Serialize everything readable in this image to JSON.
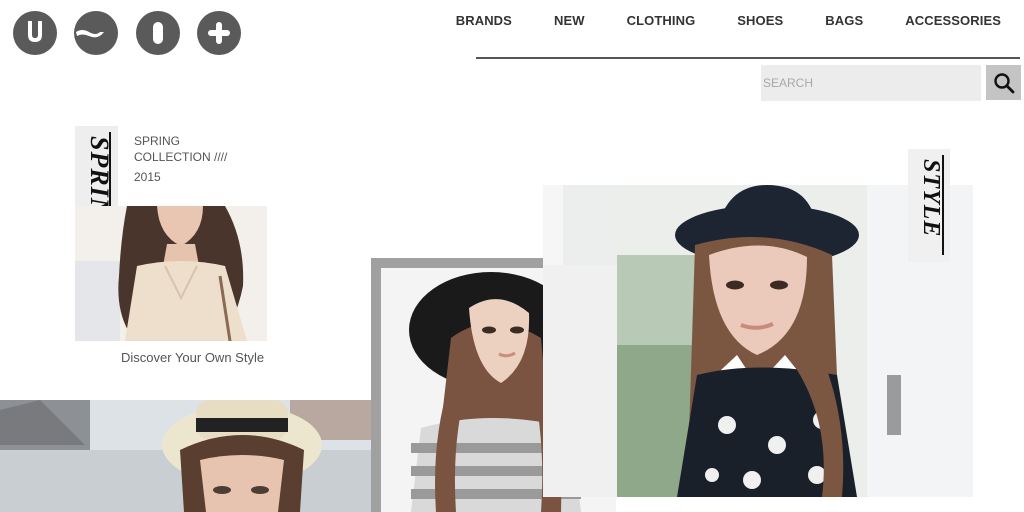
{
  "logo": {
    "alt": "USOO",
    "marks": [
      "u-mark",
      "s-mark",
      "o-mark",
      "plus-mark"
    ],
    "color": "#5a5a5a"
  },
  "nav": {
    "items": [
      "BRANDS",
      "NEW",
      "CLOTHING",
      "SHOES",
      "BAGS",
      "ACCESSORIES"
    ]
  },
  "search": {
    "placeholder": "SEARCH",
    "value": "",
    "icon": "search-icon"
  },
  "spring_block": {
    "tag_word": "SPRING",
    "collection_line": "COLLECTION ////",
    "season_line": "SPRING",
    "year": "2015",
    "caption": "Discover Your Own Style"
  },
  "style_block": {
    "tag_word": "STYLE"
  },
  "colors": {
    "accent_gray": "#a0a0a0",
    "search_bg": "#ececec",
    "search_button_bg": "#c4c4c4",
    "text_dark": "#333333"
  }
}
